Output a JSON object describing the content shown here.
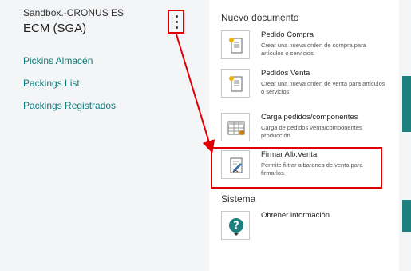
{
  "sidebar": {
    "company": "Sandbox.-CRONUS ES",
    "role_center": "ECM (SGA)",
    "links": [
      {
        "label": "Pickins Almacén"
      },
      {
        "label": "Packings List"
      },
      {
        "label": "Packings Registrados"
      }
    ]
  },
  "panel": {
    "sections": [
      {
        "title": "Nuevo documento",
        "actions": [
          {
            "icon": "new-document-icon",
            "label": "Pedido Compra",
            "description": "Crear una nueva orden de compra para artículos o servicios."
          },
          {
            "icon": "new-document-icon",
            "label": "Pedidos Venta",
            "description": "Crear una nueva orden de venta para artículos o servicios."
          },
          {
            "icon": "table-grid-icon",
            "label": "Carga pedidos/componentes",
            "description": "Carga de pedidos venta/componentes producción."
          },
          {
            "icon": "sign-document-icon",
            "label": "Firmar Alb.Venta",
            "description": "Permite filtrar albaranes de venta para firmarlos."
          }
        ]
      },
      {
        "title": "Sistema",
        "actions": [
          {
            "icon": "help-question-icon",
            "label": "Obtener información",
            "description": ""
          }
        ]
      }
    ]
  },
  "colors": {
    "link": "#107c7c",
    "highlight": "#e00000",
    "accent_strip": "#1e7f7f"
  }
}
